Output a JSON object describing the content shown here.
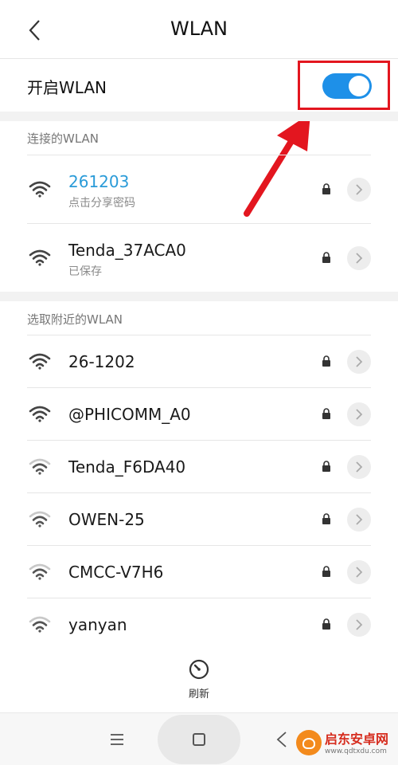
{
  "header": {
    "title": "WLAN"
  },
  "wlan_toggle": {
    "label": "开启WLAN",
    "enabled": true,
    "accent": "#1e90e8"
  },
  "connected_section": {
    "header": "连接的WLAN",
    "networks": [
      {
        "name": "261203",
        "subtitle": "点击分享密码",
        "connected": true,
        "locked": true,
        "signal": "strong"
      },
      {
        "name": "Tenda_37ACA0",
        "subtitle": "已保存",
        "connected": false,
        "locked": true,
        "signal": "strong"
      }
    ]
  },
  "nearby_section": {
    "header": "选取附近的WLAN",
    "networks": [
      {
        "name": "26-1202",
        "locked": true,
        "signal": "strong"
      },
      {
        "name": "@PHICOMM_A0",
        "locked": true,
        "signal": "strong"
      },
      {
        "name": "Tenda_F6DA40",
        "locked": true,
        "signal": "weak"
      },
      {
        "name": "OWEN-25",
        "locked": true,
        "signal": "weak"
      },
      {
        "name": "CMCC-V7H6",
        "locked": true,
        "signal": "weak"
      },
      {
        "name": "yanyan",
        "locked": true,
        "signal": "weak"
      }
    ]
  },
  "refresh": {
    "label": "刷新"
  },
  "watermark": {
    "title": "启东安卓网",
    "url": "www.qdtxdu.com"
  },
  "colors": {
    "highlight": "#e3161f",
    "connected_text": "#2a9bd8"
  }
}
